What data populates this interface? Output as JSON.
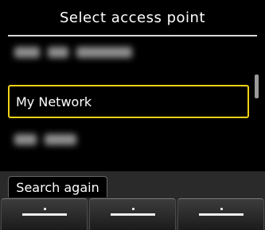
{
  "header": {
    "title": "Select access point"
  },
  "access_points": [
    {
      "label": "",
      "state": "obscured"
    },
    {
      "label": "My Network",
      "state": "selected"
    },
    {
      "label": "",
      "state": "obscured"
    }
  ],
  "colors": {
    "selection_border": "#f2d218",
    "background": "#000000",
    "bottom_bar": "#2a2a2a"
  },
  "footer": {
    "tab_label": "Search again",
    "softkeys": [
      {
        "name": "left",
        "icon": "softkey-line-icon"
      },
      {
        "name": "center",
        "icon": "softkey-line-icon"
      },
      {
        "name": "right",
        "icon": "softkey-line-icon"
      }
    ]
  }
}
